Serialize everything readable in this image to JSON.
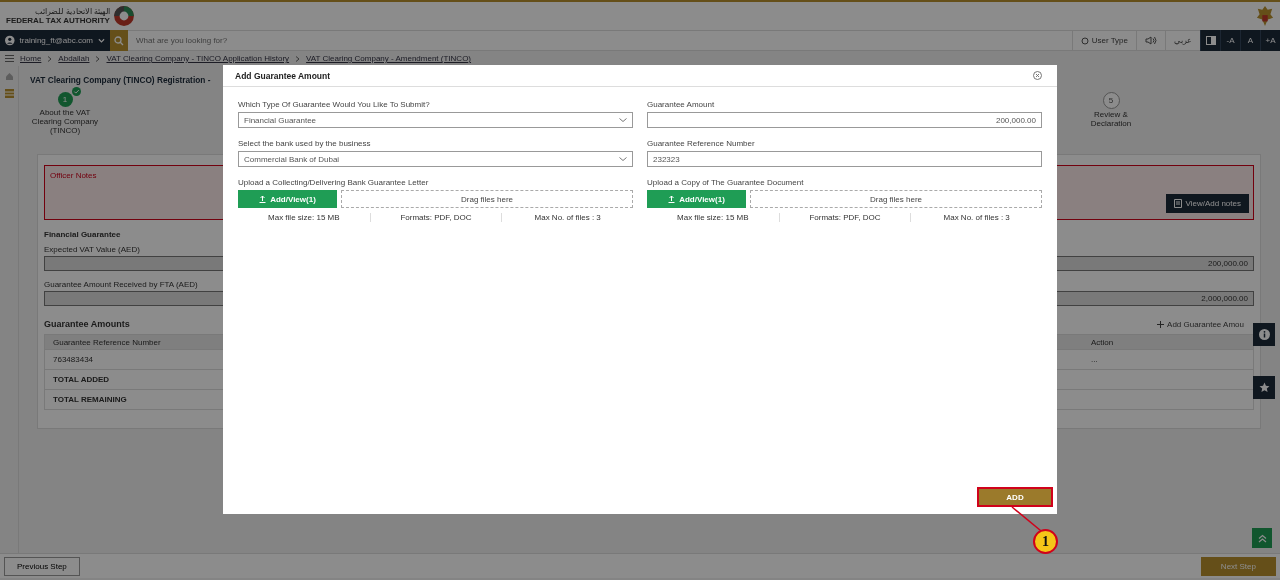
{
  "header": {
    "logo_arabic": "الهيئة الاتحادية للضرائب",
    "logo_english": "FEDERAL TAX AUTHORITY",
    "user": "training_ft@abc.com",
    "search_placeholder": "What are you looking for?",
    "user_type": "User Type",
    "language": "عربي",
    "font_buttons": [
      "-A",
      "A",
      "+A"
    ]
  },
  "breadcrumb": [
    "Home",
    "Abdallah",
    "VAT Clearing Company - TINCO Application History",
    "VAT Clearing Company - Amendment (TINCO)"
  ],
  "page_title": "VAT Clearing Company (TINCO) Registration -",
  "steps": [
    {
      "number": "1",
      "label": "About the VAT Clearing Company (TINCO)",
      "completed": true
    },
    {
      "number": "5",
      "label": "Review & Declaration",
      "completed": false
    }
  ],
  "officer_notes": {
    "title": "Officer Notes",
    "button": "View/Add notes"
  },
  "financial_guarantee": {
    "title": "Financial Guarantee",
    "fields": [
      {
        "label": "Expected VAT Value (AED)",
        "value": "200,000.00"
      },
      {
        "label": "Guarantee Amount Received by FTA (AED)",
        "value": "2,000,000.00"
      }
    ]
  },
  "guarantee_amounts": {
    "title": "Guarantee Amounts",
    "add_link": "Add Guarantee Amou",
    "columns": [
      "Guarantee Reference Number",
      "Action"
    ],
    "rows": [
      {
        "reference": "763483434",
        "action": "..."
      }
    ],
    "totals": [
      "TOTAL ADDED",
      "TOTAL REMAINING"
    ]
  },
  "footer": {
    "previous": "Previous Step",
    "next": "Next Step"
  },
  "modal": {
    "title": "Add Guarantee Amount",
    "fields": [
      {
        "kind": "select",
        "label": "Which Type Of Guarantee Would You Like To Submit?",
        "value": "Financial Guarantee"
      },
      {
        "kind": "amount",
        "label": "Guarantee Amount",
        "value": "200,000.00"
      },
      {
        "kind": "select",
        "label": "Select the bank used by the business",
        "value": "Commercial Bank of Dubai"
      },
      {
        "kind": "text",
        "label": "Guarantee Reference Number",
        "value": "232323"
      },
      {
        "kind": "upload",
        "label": "Upload a Collecting/Delivering Bank Guarantee Letter",
        "button": "Add/View(1)",
        "drop": "Drag files here",
        "info": [
          "Max file size: 15 MB",
          "Formats: PDF, DOC",
          "Max No. of files : 3"
        ]
      },
      {
        "kind": "upload",
        "label": "Upload a Copy of The Guarantee Document",
        "button": "Add/View(1)",
        "drop": "Drag files here",
        "info": [
          "Max file size: 15 MB",
          "Formats: PDF, DOC",
          "Max No. of files : 3"
        ]
      }
    ],
    "add_button": "ADD"
  },
  "callout": {
    "number": "1"
  }
}
